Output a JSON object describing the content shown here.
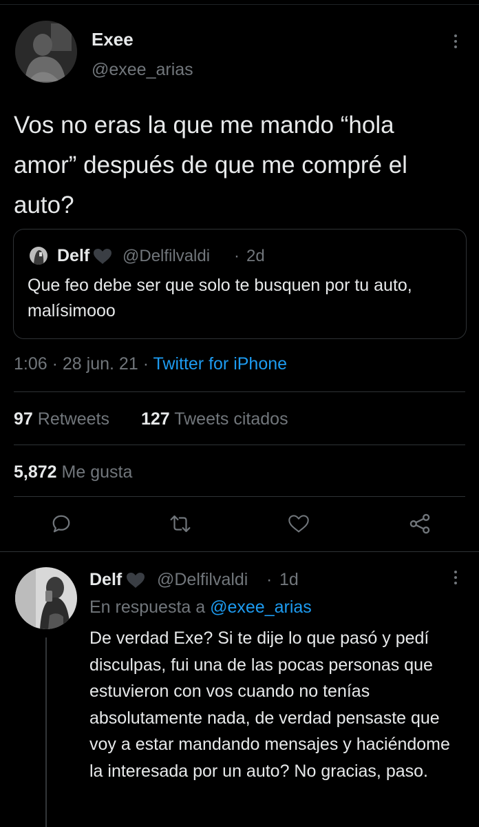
{
  "tweet": {
    "author_name": "Exee",
    "author_handle": "@exee_arias",
    "text": "Vos no eras la que me mando “hola amor” después de que me compré el auto?",
    "quote": {
      "author_name": "Delf",
      "author_handle": "@Delfilvaldi",
      "separator": "·",
      "time": "2d",
      "text": "Que feo debe ser que solo te busquen por tu auto, malísimooo"
    },
    "meta": {
      "time": "1:06",
      "date": "28 jun. 21",
      "separator": "·",
      "client": "Twitter for iPhone"
    },
    "stats": {
      "retweets_count": "97",
      "retweets_label": "Retweets",
      "quotes_count": "127",
      "quotes_label": "Tweets citados",
      "likes_count": "5,872",
      "likes_label": "Me gusta"
    },
    "actions": [
      "reply-icon",
      "retweet-icon",
      "like-icon",
      "share-icon"
    ]
  },
  "reply": {
    "author_name": "Delf",
    "author_handle": "@Delfilvaldi",
    "separator": "·",
    "time": "1d",
    "replying_to_prefix": "En respuesta a",
    "replying_to_handle": "@exee_arias",
    "text": "De verdad Exe? Si te dije lo que pasó y pedí disculpas, fui una de las pocas personas que estuvieron con vos cuando no tenías absolutamente nada, de verdad pensaste que voy a estar mandando mensajes y haciéndome la interesada por un auto? No gracias, paso."
  },
  "colors": {
    "background": "#000000",
    "text": "#e7e9ea",
    "muted": "#71767b",
    "link": "#1d9bf0",
    "border": "#2f3336"
  }
}
